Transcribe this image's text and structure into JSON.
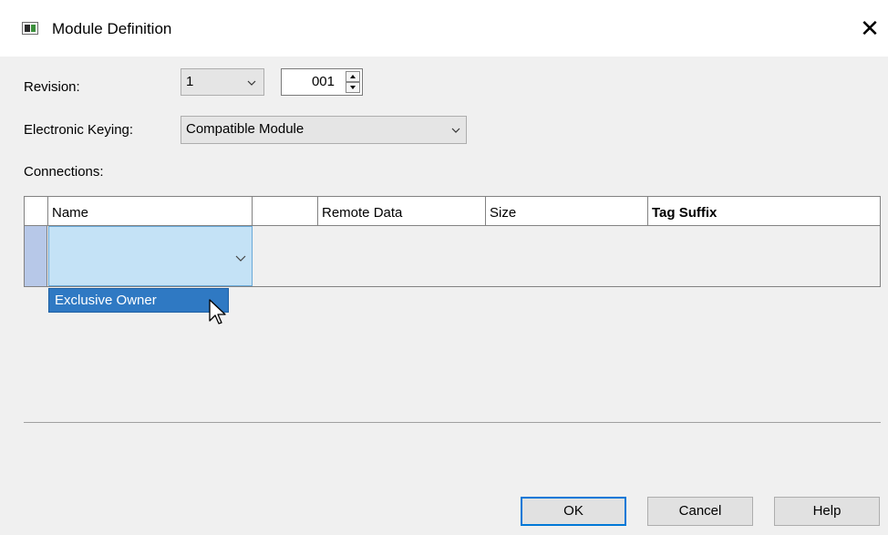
{
  "window": {
    "title": "Module Definition"
  },
  "revision": {
    "label": "Revision:",
    "major": "1",
    "minor": "001"
  },
  "keying": {
    "label": "Electronic Keying:",
    "value": "Compatible Module"
  },
  "connections": {
    "label": "Connections:",
    "columns": [
      "Name",
      "",
      "Remote Data",
      "Size",
      "Tag Suffix"
    ],
    "dropdown_option": "Exclusive Owner"
  },
  "buttons": {
    "ok": "OK",
    "cancel": "Cancel",
    "help": "Help"
  },
  "colors": {
    "accent": "#0078d7",
    "selection": "#2f79c3",
    "cell_highlight": "#c4e2f6"
  }
}
